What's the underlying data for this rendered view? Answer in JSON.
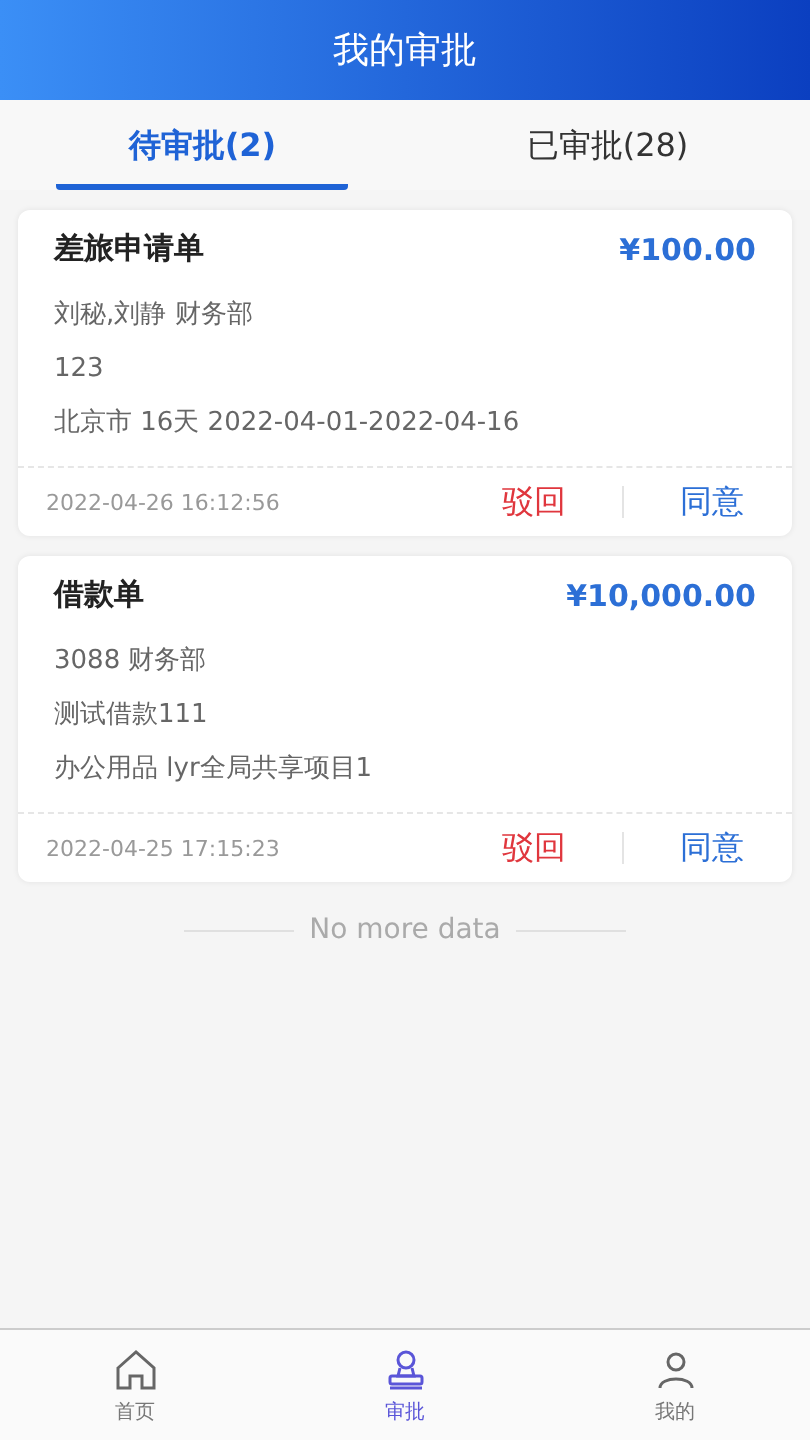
{
  "header": {
    "title": "我的审批"
  },
  "tabs": [
    {
      "label": "待审批(2)",
      "selected": true
    },
    {
      "label": "已审批(28)",
      "selected": false
    }
  ],
  "cards": [
    {
      "title": "差旅申请单",
      "amount": "¥100.00",
      "lines": [
        "刘秘,刘静 财务部",
        "123",
        "北京市 16天 2022-04-01-2022-04-16"
      ],
      "time": "2022-04-26 16:12:56",
      "reject": "驳回",
      "approve": "同意"
    },
    {
      "title": "借款单",
      "amount": "¥10,000.00",
      "lines": [
        "3088 财务部",
        "测试借款111",
        "办公用品 lyr全局共享项目1"
      ],
      "time": "2022-04-25 17:15:23",
      "reject": "驳回",
      "approve": "同意"
    }
  ],
  "end_note": "No more data",
  "bottom_nav": [
    {
      "label": "首页",
      "kind": "home",
      "selected": false
    },
    {
      "label": "审批",
      "kind": "stamp",
      "selected": true
    },
    {
      "label": "我的",
      "kind": "user",
      "selected": false
    }
  ]
}
